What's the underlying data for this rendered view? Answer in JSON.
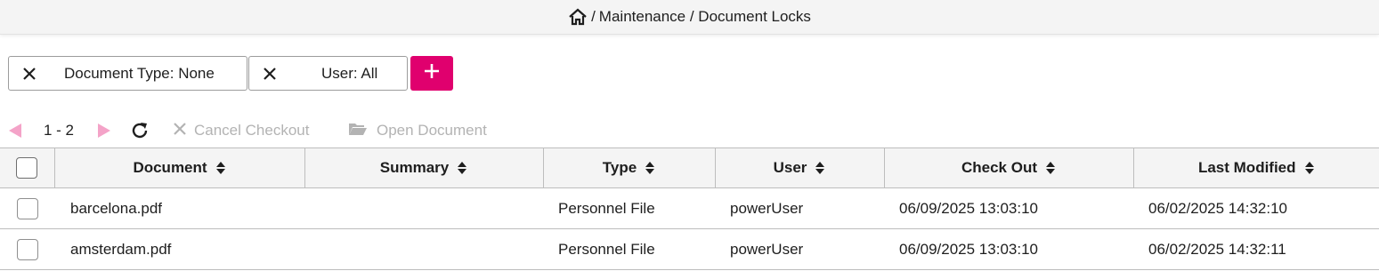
{
  "breadcrumb": {
    "separator": "/",
    "path": "Maintenance / Document Locks",
    "home_icon": "home-icon"
  },
  "filters": [
    {
      "label": "Document Type: None",
      "remove_icon": "close-icon"
    },
    {
      "label": "User: All",
      "remove_icon": "close-icon"
    }
  ],
  "add_filter": {
    "icon": "plus-icon",
    "color": "#e0006e"
  },
  "toolbar": {
    "range": "1 - 2",
    "cancel_checkout": "Cancel Checkout",
    "open_document": "Open Document",
    "nav_arrow_color": "#f4a3c8",
    "disabled_color": "#b3b3b3"
  },
  "table": {
    "columns": [
      "Document",
      "Summary",
      "Type",
      "User",
      "Check Out",
      "Last Modified"
    ],
    "rows": [
      {
        "document": "barcelona.pdf",
        "summary": "",
        "type": "Personnel File",
        "user": "powerUser",
        "check_out": "06/09/2025 13:03:10",
        "last_modified": "06/02/2025 14:32:10"
      },
      {
        "document": "amsterdam.pdf",
        "summary": "",
        "type": "Personnel File",
        "user": "powerUser",
        "check_out": "06/09/2025 13:03:10",
        "last_modified": "06/02/2025 14:32:11"
      }
    ]
  }
}
